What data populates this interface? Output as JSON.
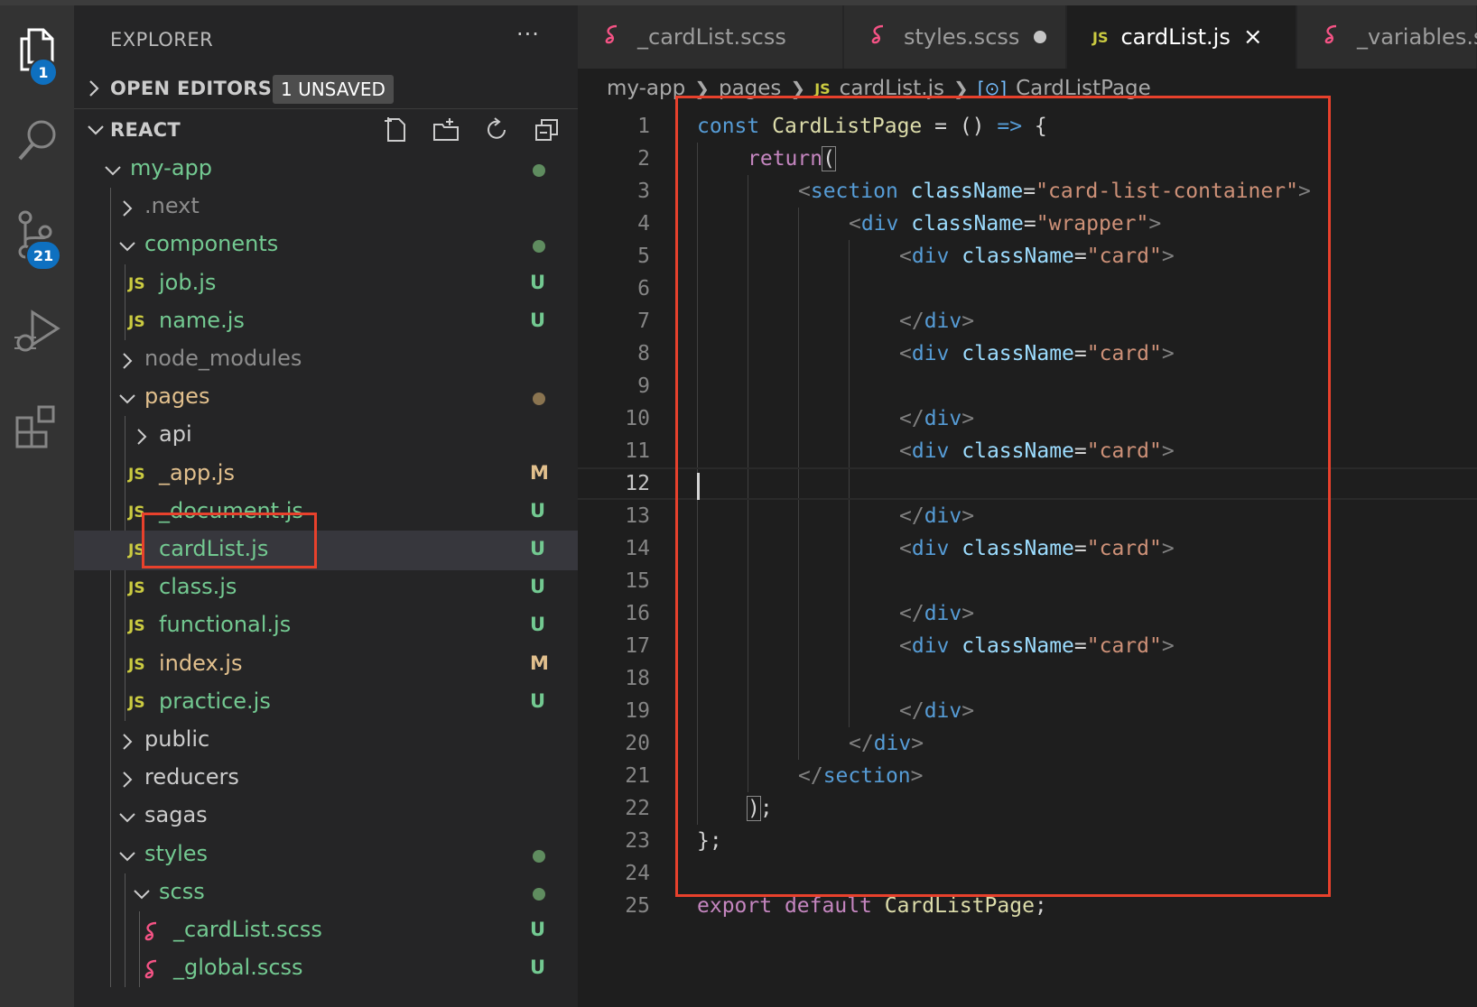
{
  "activity": {
    "explorer_badge": "1",
    "scm_badge": "21"
  },
  "sidebar": {
    "title": "EXPLORER",
    "more": "···",
    "open_editors": {
      "label": "OPEN EDITORS",
      "badge": "1 UNSAVED"
    },
    "workspace": {
      "label": "REACT"
    },
    "tree": [
      {
        "label": "my-app",
        "kind": "folder-open",
        "status": "dot-green"
      },
      {
        "label": ".next",
        "kind": "folder",
        "status": ""
      },
      {
        "label": "components",
        "kind": "folder-open",
        "status": "dot-green"
      },
      {
        "label": "job.js",
        "kind": "js",
        "status": "U"
      },
      {
        "label": "name.js",
        "kind": "js",
        "status": "U"
      },
      {
        "label": "node_modules",
        "kind": "folder",
        "status": ""
      },
      {
        "label": "pages",
        "kind": "folder-open",
        "status": "dot-brown"
      },
      {
        "label": "api",
        "kind": "folder",
        "status": ""
      },
      {
        "label": "_app.js",
        "kind": "js",
        "status": "M"
      },
      {
        "label": "_document.js",
        "kind": "js",
        "status": "U"
      },
      {
        "label": "cardList.js",
        "kind": "js",
        "status": "U"
      },
      {
        "label": "class.js",
        "kind": "js",
        "status": "U"
      },
      {
        "label": "functional.js",
        "kind": "js",
        "status": "U"
      },
      {
        "label": "index.js",
        "kind": "js",
        "status": "M"
      },
      {
        "label": "practice.js",
        "kind": "js",
        "status": "U"
      },
      {
        "label": "public",
        "kind": "folder",
        "status": ""
      },
      {
        "label": "reducers",
        "kind": "folder",
        "status": ""
      },
      {
        "label": "sagas",
        "kind": "folder-open",
        "status": ""
      },
      {
        "label": "styles",
        "kind": "folder-open",
        "status": "dot-green"
      },
      {
        "label": "scss",
        "kind": "folder-open",
        "status": "dot-green"
      },
      {
        "label": "_cardList.scss",
        "kind": "scss",
        "status": "U"
      },
      {
        "label": "_global.scss",
        "kind": "scss",
        "status": "U"
      }
    ]
  },
  "editor": {
    "tabs": [
      {
        "label": "_cardList.scss",
        "kind": "scss"
      },
      {
        "label": "styles.scss",
        "kind": "scss",
        "unsaved": true
      },
      {
        "label": "cardList.js",
        "kind": "js",
        "active": true,
        "close": "×"
      },
      {
        "label": "_variables.s",
        "kind": "scss"
      }
    ],
    "breadcrumb": {
      "parts": [
        "my-app",
        "pages",
        "cardList.js",
        "CardListPage"
      ],
      "js": "JS",
      "symbol": "[⊙]"
    },
    "current_line": 12,
    "line_numbers": [
      "1",
      "2",
      "3",
      "4",
      "5",
      "6",
      "7",
      "8",
      "9",
      "10",
      "11",
      "12",
      "13",
      "14",
      "15",
      "16",
      "17",
      "18",
      "19",
      "20",
      "21",
      "22",
      "23",
      "24",
      "25"
    ],
    "code": {
      "l1": {
        "kw": "const",
        "name": "CardListPage",
        "eq": " = ",
        "paren": "()",
        "arrow": " => ",
        "brace": "{"
      },
      "l2": {
        "kw": "return",
        "paren": "("
      },
      "l3": {
        "open": "<",
        "tag": "section",
        "attr": "className",
        "eq": "=",
        "val": "\"card-list-container\"",
        "close": ">"
      },
      "l4": {
        "open": "<",
        "tag": "div",
        "attr": "className",
        "eq": "=",
        "val": "\"wrapper\"",
        "close": ">"
      },
      "div_card": {
        "open": "<",
        "tag": "div",
        "attr": "className",
        "eq": "=",
        "val": "\"card\"",
        "close": ">"
      },
      "end_div": {
        "open": "</",
        "tag": "div",
        "close": ">"
      },
      "l21": {
        "open": "</",
        "tag": "section",
        "close": ">"
      },
      "l22": {
        "paren": ")",
        "semi": ";"
      },
      "l23": {
        "text": "};"
      },
      "l25": {
        "kw1": "export",
        "kw2": "default",
        "name": "CardListPage",
        "semi": ";"
      }
    }
  },
  "colors": {
    "accent": "#0e70c0",
    "highlight_box": "#e8412c",
    "js_icon": "#cbcb41",
    "scss_icon": "#f55385",
    "untracked": "#73c991",
    "modified": "#e2c08d"
  }
}
